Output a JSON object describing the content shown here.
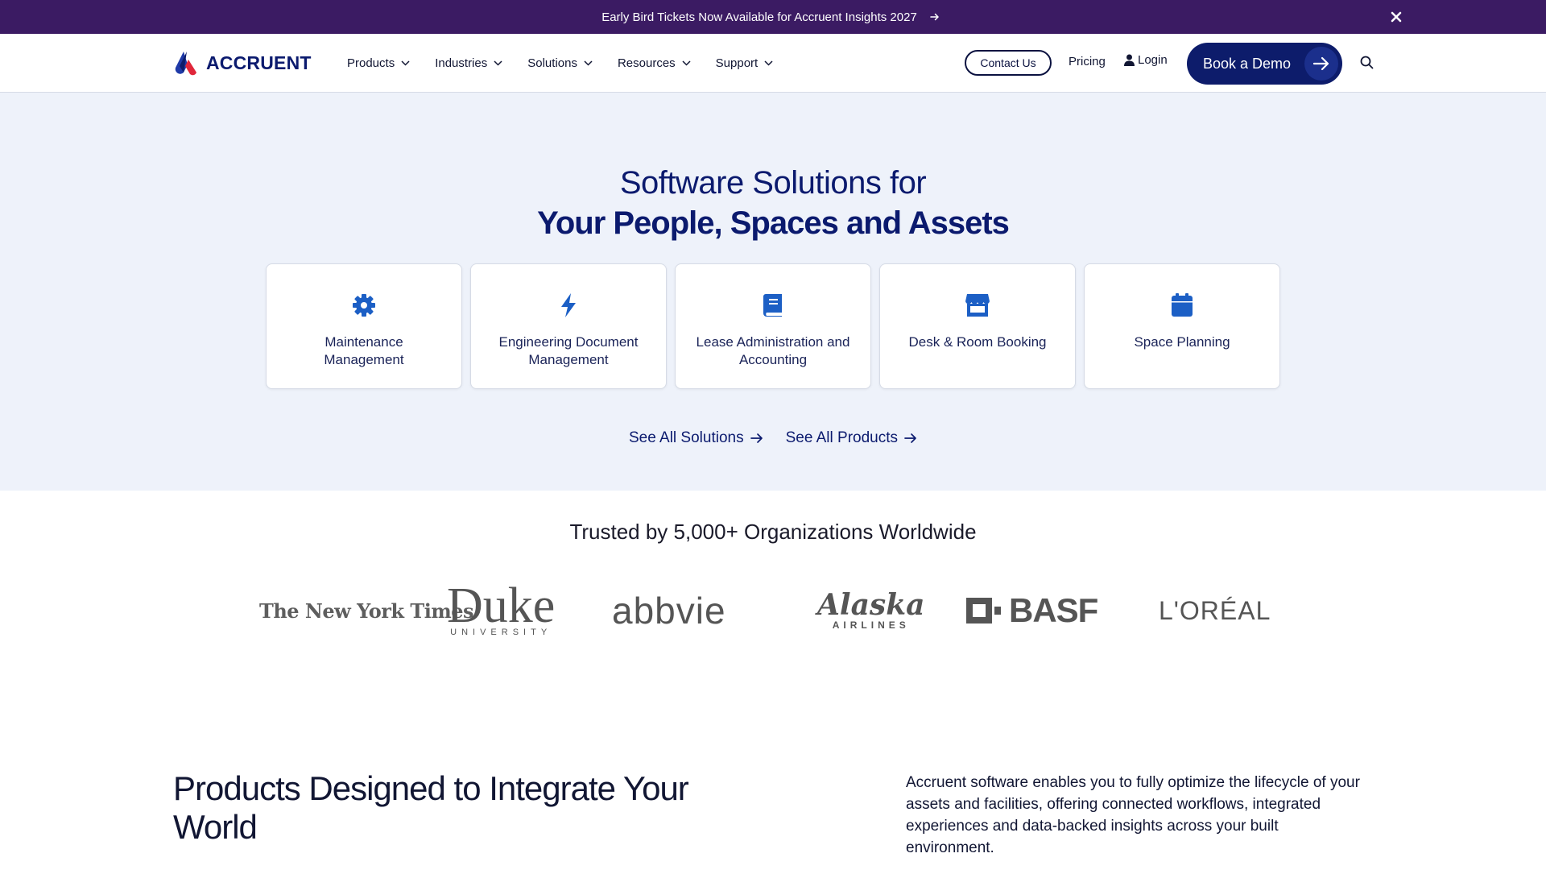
{
  "announcement": {
    "text": "Early Bird Tickets Now Available for Accruent Insights 2027",
    "arrow_icon": "arrow-right-icon",
    "close_icon": "close-icon"
  },
  "header": {
    "logo_text": "ACCRUENT",
    "nav": [
      {
        "label": "Products"
      },
      {
        "label": "Industries"
      },
      {
        "label": "Solutions"
      },
      {
        "label": "Resources"
      },
      {
        "label": "Support"
      }
    ],
    "contact_label": "Contact Us",
    "pricing_label": "Pricing",
    "login_label": "Login",
    "demo_label": "Book a Demo"
  },
  "hero": {
    "title_line1": "Software Solutions for",
    "title_line2": "Your People, Spaces and Assets",
    "cards": [
      {
        "label": "Maintenance Management",
        "icon": "gear-icon"
      },
      {
        "label": "Engineering Document Management",
        "icon": "bolt-icon"
      },
      {
        "label": "Lease Administration and Accounting",
        "icon": "book-icon"
      },
      {
        "label": "Desk & Room Booking",
        "icon": "store-icon"
      },
      {
        "label": "Space Planning",
        "icon": "calendar-icon"
      }
    ],
    "see_all_solutions": "See All Solutions",
    "see_all_products": "See All Products"
  },
  "trusted": {
    "heading": "Trusted by 5,000+ Organizations Worldwide",
    "logos": {
      "nyt": "The New York Times",
      "duke": "Duke",
      "duke_sub": "UNIVERSITY",
      "abbvie": "abbvie",
      "alaska": "Alaska",
      "alaska_sub": "AIRLINES",
      "basf": "BASF",
      "oreal": "L'ORÉAL"
    }
  },
  "products": {
    "title": "Products Designed to Integrate Your World",
    "description": "Accruent software enables you to fully optimize the lifecycle of your assets and facilities, offering connected workflows, integrated experiences and data-backed insights across your built environment."
  },
  "colors": {
    "announcement_bg": "#3b1b63",
    "brand_navy": "#0d1c6b",
    "icon_blue": "#1c5fc5",
    "hero_bg": "#eef2fa"
  }
}
